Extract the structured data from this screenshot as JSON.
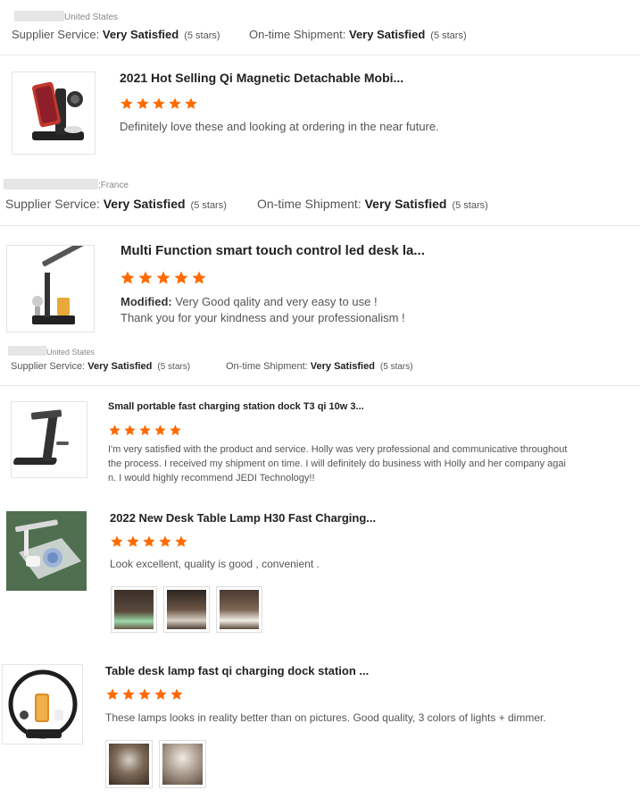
{
  "colors": {
    "star": "#ff6a00",
    "text": "#333333",
    "muted": "#888888",
    "divider": "#e8e8e8"
  },
  "rating_label": "(5 stars)",
  "labels": {
    "supplier_service": "Supplier Service:",
    "ontime_shipment": "On-time Shipment:",
    "very_satisfied": "Very Satisfied",
    "modified": "Modified:"
  },
  "top_block": {
    "country": "United States"
  },
  "reviews": [
    {
      "title": "2021 Hot Selling Qi Magnetic Detachable Mobi...",
      "rating": 5,
      "text": "Definitely love these and looking at ordering in the near future.",
      "country": ";France",
      "thumb_icon": "charging-dock-image"
    },
    {
      "title": "Multi Function smart touch control led desk la...",
      "rating": 5,
      "text_line1": "Very Good qality and very easy to use !",
      "text_line2": "Thank you for your kindness and your professionalism !",
      "country": "United States",
      "thumb_icon": "desk-lamp-image"
    },
    {
      "title": "Small portable fast charging station dock T3 qi 10w 3...",
      "rating": 5,
      "text_line1": "I'm very satisfied with the product and service. Holly was very professional and communicative throughout",
      "text_line2": "the process. I received my shipment on time. I will definitely do business with Holly and her company agai",
      "text_line3": "n. I would highly recommend JEDI Technology!!",
      "thumb_icon": "charging-station-image"
    },
    {
      "title": "2022 New Desk Table Lamp H30 Fast Charging...",
      "rating": 5,
      "text": "Look excellent, quality is good , convenient .",
      "photo_count": 3,
      "thumb_icon": "lamp-charger-image"
    },
    {
      "title": "Table desk lamp fast qi charging dock station ...",
      "rating": 5,
      "text": "These lamps looks in reality better than on pictures. Good quality, 3 colors of lights + dimmer.",
      "photo_count": 2,
      "thumb_icon": "ring-lamp-image"
    }
  ]
}
